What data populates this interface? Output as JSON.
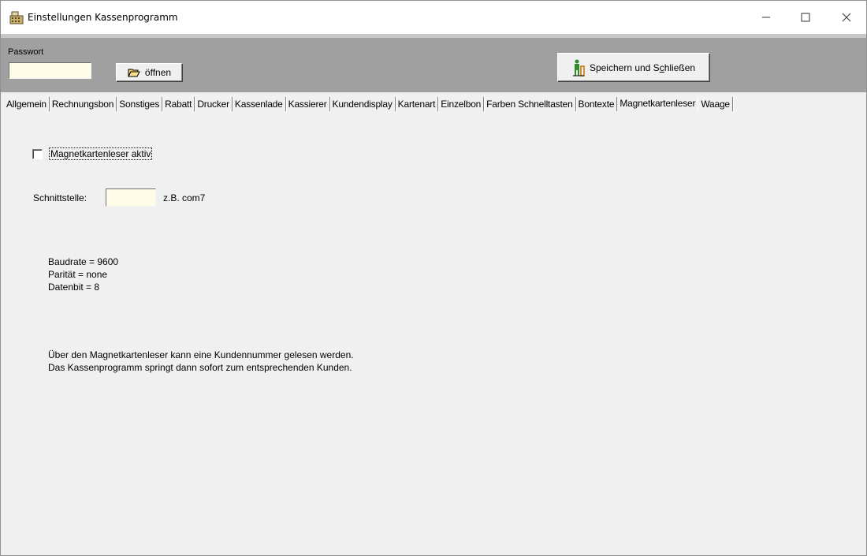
{
  "window": {
    "title": "Einstellungen Kassenprogramm",
    "controls": {
      "minimize_icon": "minimize-icon",
      "maximize_icon": "maximize-icon",
      "close_icon": "close-icon"
    }
  },
  "toolbar": {
    "password_label": "Passwort",
    "password_value": "",
    "open_label": "öffnen",
    "save_label_pre": "Speichern und S",
    "save_label_underlined": "c",
    "save_label_post": "hließen"
  },
  "tabs": [
    {
      "label": "Allgemein"
    },
    {
      "label": "Rechnungsbon"
    },
    {
      "label": "Sonstiges"
    },
    {
      "label": "Rabatt"
    },
    {
      "label": "Drucker"
    },
    {
      "label": "Kassenlade"
    },
    {
      "label": "Kassierer"
    },
    {
      "label": "Kundendisplay"
    },
    {
      "label": "Kartenart"
    },
    {
      "label": "Einzelbon"
    },
    {
      "label": "Farben Schnelltasten"
    },
    {
      "label": "Bontexte"
    },
    {
      "label": "Magnetkartenleser"
    },
    {
      "label": "Waage"
    }
  ],
  "active_tab": "Magnetkartenleser",
  "magnet": {
    "checkbox_label": "Magnetkartenleser aktiv",
    "checked": false,
    "port_label": "Schnittstelle:",
    "port_value": "",
    "port_hint": "z.B. com7",
    "settings": [
      "Baudrate = 9600",
      "Parität = none",
      "Datenbit = 8"
    ],
    "info": [
      "Über den Magnetkartenleser kann eine Kundennummer gelesen werden.",
      "Das Kassenprogramm springt dann sofort zum entsprechenden Kunden."
    ]
  },
  "colors": {
    "toolbar_bg": "#a0a0a0",
    "input_bg": "#fffde8",
    "window_bg": "#f0f0f0"
  }
}
